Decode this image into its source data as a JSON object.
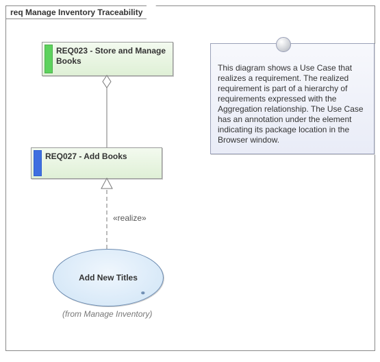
{
  "frame": {
    "title": "req Manage Inventory Traceability"
  },
  "elements": {
    "req023": {
      "label": "REQ023 - Store and Manage Books"
    },
    "req027": {
      "label": "REQ027 - Add Books"
    },
    "usecase": {
      "label": "Add New Titles",
      "from": "(from Manage Inventory)"
    }
  },
  "relations": {
    "aggregation": {
      "from": "req027",
      "to": "req023",
      "kind": "aggregation"
    },
    "realize": {
      "from": "usecase",
      "to": "req027",
      "kind": "realize",
      "label": "«realize»"
    }
  },
  "note": {
    "text": "This diagram shows a Use Case that realizes a requirement. The realized requirement is part of a hierarchy of requirements expressed with the Aggregation relationship. The Use Case has an annotation under the element indicating its package location in the Browser window."
  }
}
